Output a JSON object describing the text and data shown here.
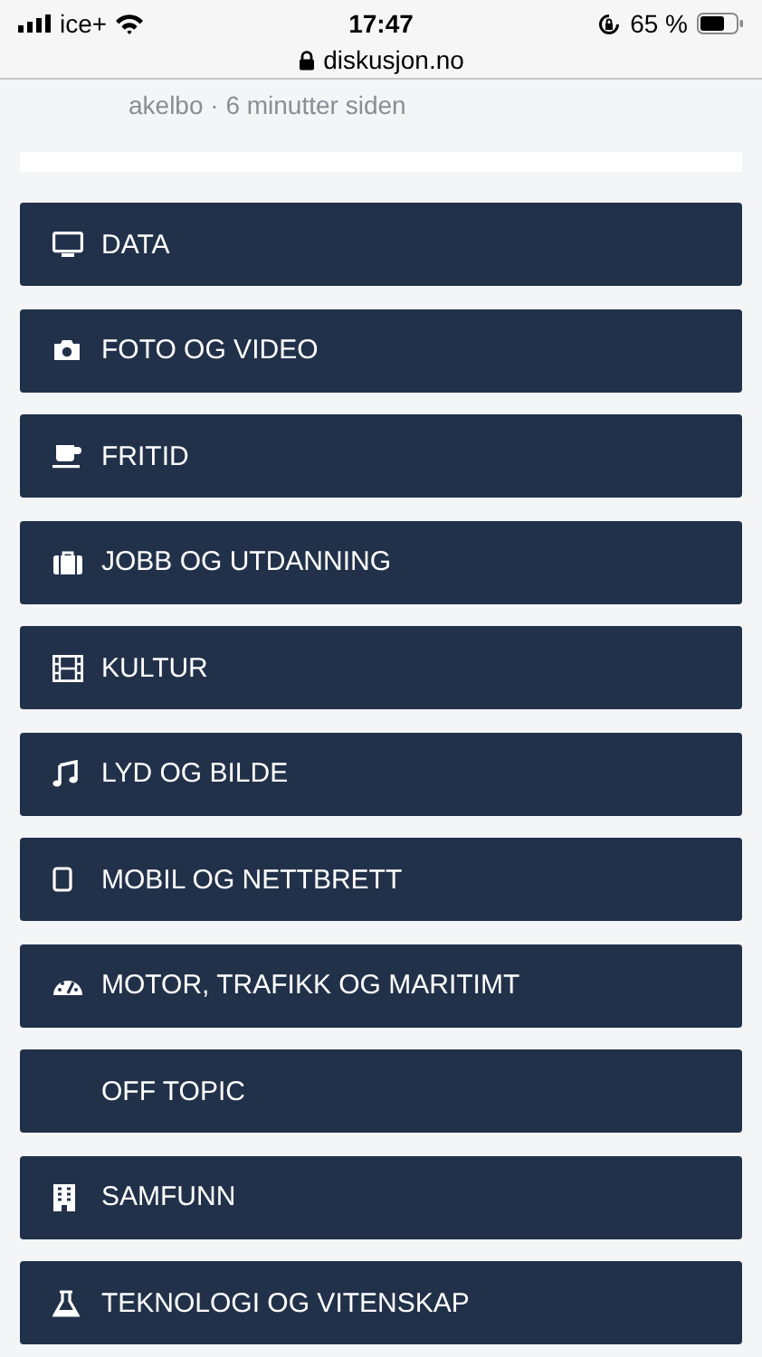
{
  "status_bar": {
    "carrier": "ice+",
    "time": "17:47",
    "battery": "65 %"
  },
  "address_bar": {
    "url": "diskusjon.no"
  },
  "post_meta": "akelbo · 6 minutter siden",
  "categories": [
    {
      "label": "DATA"
    },
    {
      "label": "FOTO OG VIDEO"
    },
    {
      "label": "FRITID"
    },
    {
      "label": "JOBB OG UTDANNING"
    },
    {
      "label": "KULTUR"
    },
    {
      "label": "LYD OG BILDE"
    },
    {
      "label": "MOBIL OG NETTBRETT"
    },
    {
      "label": "MOTOR, TRAFIKK OG MARITIMT"
    },
    {
      "label": "OFF TOPIC"
    },
    {
      "label": "SAMFUNN"
    },
    {
      "label": "TEKNOLOGI OG VITENSKAP"
    }
  ]
}
